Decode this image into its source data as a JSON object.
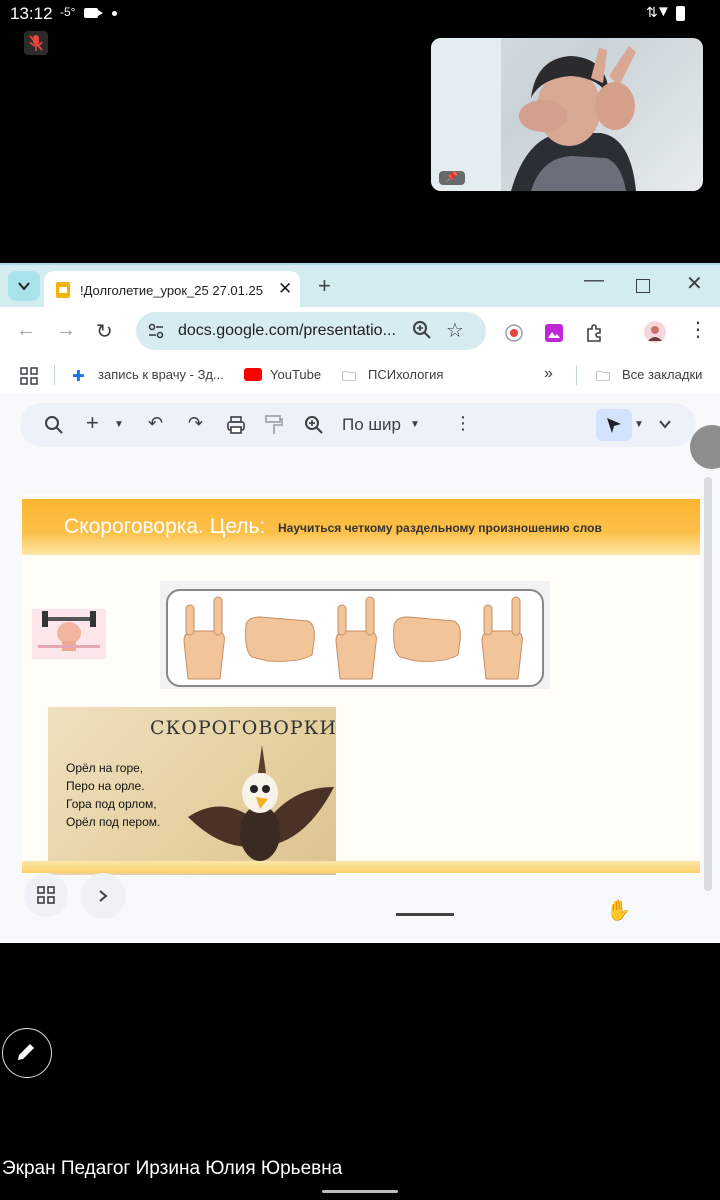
{
  "status_bar": {
    "time": "13:12",
    "temperature": "-5°"
  },
  "video": {
    "pin_label": ""
  },
  "browser": {
    "tab_title": "!Долголетие_урок_25 27.01.25",
    "url": "docs.google.com/presentatio..."
  },
  "bookmarks": {
    "item1": "запись к врачу - Зд...",
    "item2": "YouTube",
    "item3": "ПСИхология",
    "more": "»",
    "all": "Все закладки"
  },
  "docs_toolbar": {
    "zoom_label": "По шир"
  },
  "slide": {
    "title": "Скороговорка. Цель:",
    "goal": "Научиться четкому раздельному произношению слов",
    "tongue_twister": {
      "heading": "СКОРОГОВОРКИ",
      "lines": [
        "Орёл на горе,",
        "Перо на орле.",
        "Гора под орлом,",
        "Орёл под пером."
      ]
    }
  },
  "caption": "Экран Педагог Ирзина Юлия Юрьевна",
  "colors": {
    "banner": "#fbb630",
    "tabbar": "#d3ecef",
    "omnibox": "#d6ecf1",
    "docs_toolbar": "#edf2fa"
  }
}
